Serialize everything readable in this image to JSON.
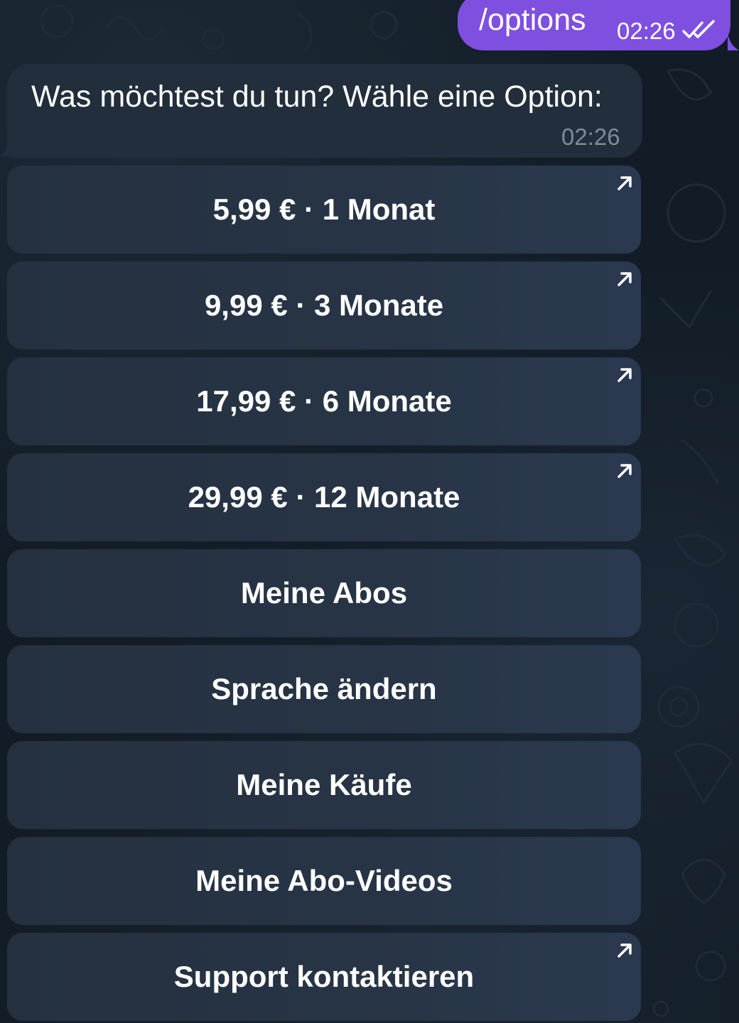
{
  "outgoing_message": {
    "text": "/options",
    "time": "02:26",
    "status_icon": "double-check-icon"
  },
  "incoming_message": {
    "text": "Was möchtest du tun? Wähle eine Option:",
    "time": "02:26"
  },
  "inline_keyboard": [
    {
      "label": "5,99 € · 1 Monat",
      "icon": "external-arrow-icon"
    },
    {
      "label": "9,99 € · 3 Monate",
      "icon": "external-arrow-icon"
    },
    {
      "label": "17,99 € · 6 Monate",
      "icon": "external-arrow-icon"
    },
    {
      "label": "29,99 € · 12 Monate",
      "icon": "external-arrow-icon"
    },
    {
      "label": "Meine Abos"
    },
    {
      "label": "Sprache ändern"
    },
    {
      "label": "Meine Käufe"
    },
    {
      "label": "Meine Abo-Videos"
    },
    {
      "label": "Support kontaktieren",
      "icon": "external-arrow-icon"
    }
  ],
  "colors": {
    "outgoing_bubble": "#7f4fe0",
    "incoming_bubble": "#222e3c",
    "button_background": "#273445",
    "background": "#111c26"
  }
}
